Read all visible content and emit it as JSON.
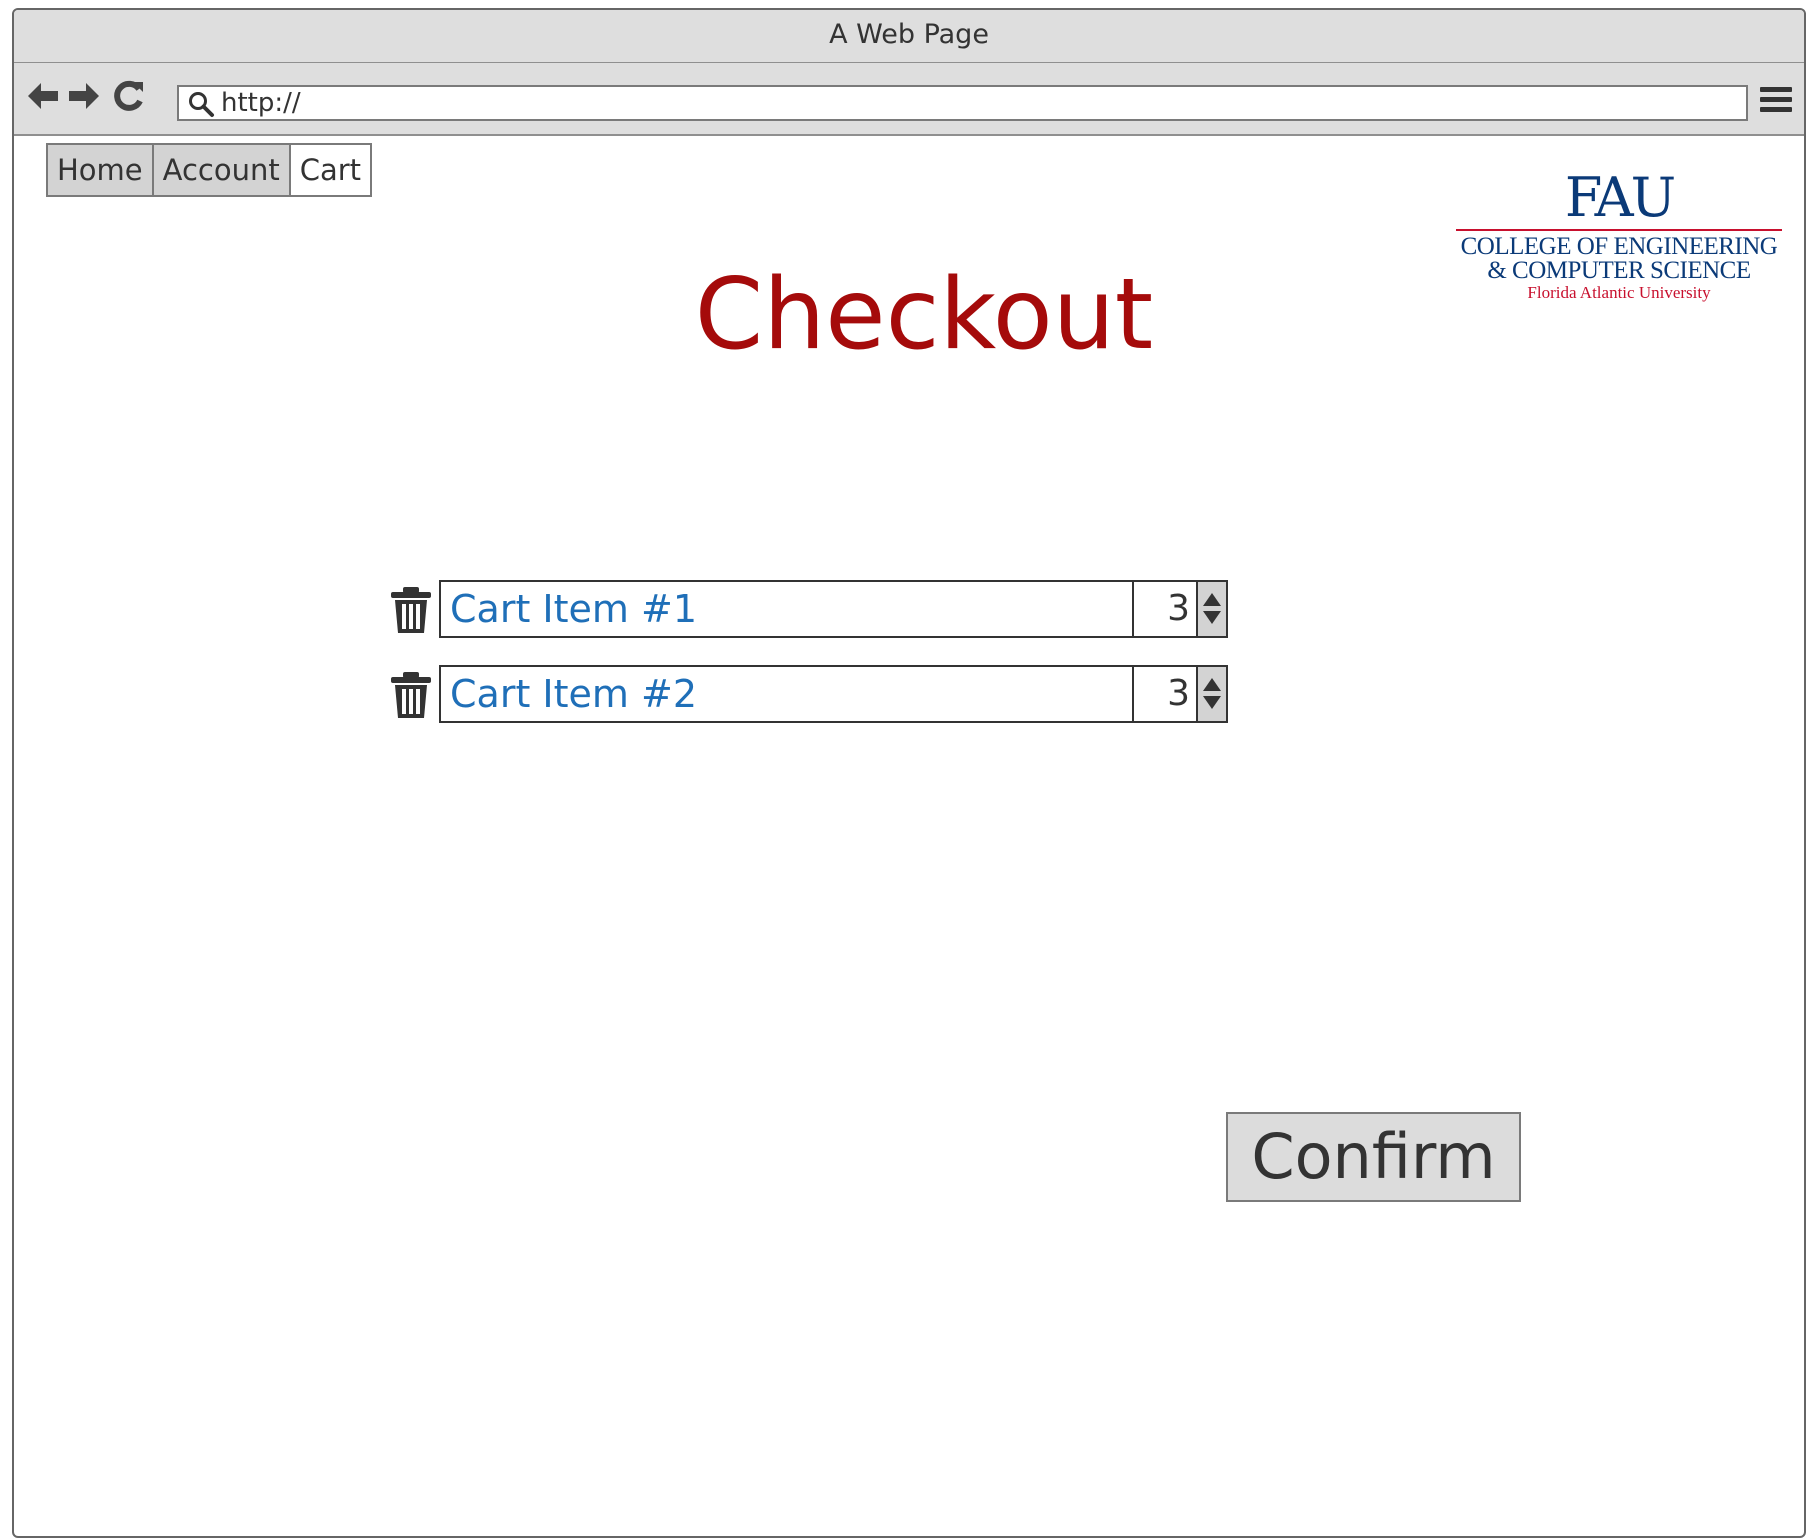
{
  "window": {
    "title": "A Web Page"
  },
  "toolbar": {
    "back_icon": "arrow-left-icon",
    "forward_icon": "arrow-right-icon",
    "reload_icon": "reload-icon",
    "address_value": "http://",
    "search_icon": "search-icon",
    "menu_icon": "hamburger-menu-icon"
  },
  "tabs": [
    {
      "label": "Home",
      "active": false
    },
    {
      "label": "Account",
      "active": false
    },
    {
      "label": "Cart",
      "active": true
    }
  ],
  "logo": {
    "mark": "FAU",
    "line1": "COLLEGE OF ENGINEERING",
    "line2": "& COMPUTER SCIENCE",
    "line3": "Florida Atlantic University",
    "colors": {
      "blue": "#0b3a78",
      "red": "#c8102e"
    }
  },
  "page": {
    "title": "Checkout",
    "title_color": "#a50b0b"
  },
  "cart": {
    "items": [
      {
        "name": "Cart Item #1",
        "quantity": "3",
        "remove_icon": "trash-icon"
      },
      {
        "name": "Cart Item #2",
        "quantity": "3",
        "remove_icon": "trash-icon"
      }
    ]
  },
  "actions": {
    "confirm_label": "Confirm"
  }
}
